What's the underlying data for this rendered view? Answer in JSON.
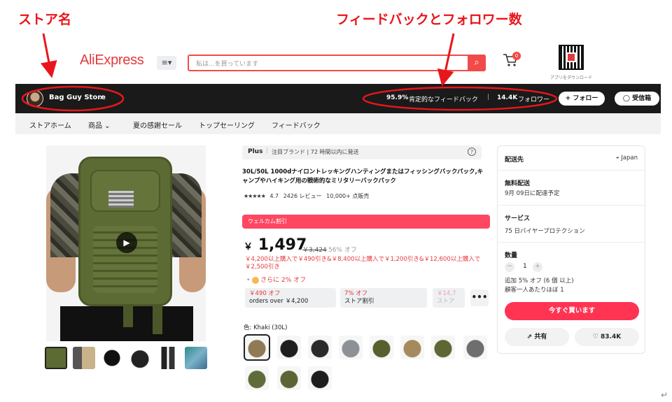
{
  "annotations": {
    "store_name_label": "ストア名",
    "feedback_label": "フィードバックとフォロワー数"
  },
  "header": {
    "logo": "AliExpress",
    "menu_icon": "≡▾",
    "search_placeholder": "私は...を買っています",
    "search_icon": "⌕",
    "cart_icon": "🛒",
    "cart_count": "0",
    "qr_label": "アプリをダウンロード"
  },
  "store": {
    "name": "Bag Guy Store",
    "chevron": "›",
    "feedback_pct": "95.9%",
    "feedback_text": "肯定的なフィードバック",
    "separator": "|",
    "followers_count": "14.4K",
    "followers_text": "フォロワー",
    "follow_button": "+ フォロー",
    "inbox_button": "◯ 受信箱"
  },
  "nav": [
    "ストアホーム",
    "商品 ⌄",
    "夏の感謝セール",
    "トップセーリング",
    "フィードバック"
  ],
  "product": {
    "plus_badge": "Plus",
    "plus_sep": "|",
    "plus_text": "注目ブランド | 72 時間以内に発送",
    "info_icon": "?",
    "title": "30L/50L 1000dナイロントレッキングハンティングまたはフィッシングバックパック,キャンプやハイキング用の戦術的なミリタリーバックパック",
    "stars": "★★★★★",
    "rating": "4.7",
    "reviews": "2426 レビュー",
    "sold": "10,000+ 点販売",
    "welcome_banner": "ウェルカム割引",
    "currency": "￥",
    "price": "1,497",
    "old_price": "￥3,424",
    "discount": "56% オフ",
    "promo_text": "￥4,200以上購入で￥490引き&￥8,400以上購入で￥1,200引き&￥12,600以上購入で￥2,500引き",
    "extra_discount": "さらに 2% オフ",
    "coupons": [
      {
        "title": "￥490 オフ",
        "sub": "orders over ￥4,200"
      },
      {
        "title": "7% オフ",
        "sub": "ストア割引"
      },
      {
        "title": "￥14,7",
        "sub": "ストア"
      }
    ],
    "more_icon": "•••",
    "color_label": "色: Khaki (30L)",
    "play_icon": "▶"
  },
  "sidebar": {
    "ship_to_label": "配送先",
    "location": "⌖ Japan",
    "free_ship_label": "無料配送",
    "delivery": "9月 09日に配達予定",
    "service_label": "サービス",
    "service": "75 日バイヤープロテクション",
    "qty_label": "数量",
    "qty_minus": "−",
    "qty_value": "1",
    "qty_plus": "+",
    "qty_note1": "追加 5% オフ (6 個 以上)",
    "qty_note2": "顧客一人あたりほぼ 1",
    "buy_button": "今すぐ買います",
    "share_button": "⇗ 共有",
    "wishlist_button": "♡ 83.4K"
  },
  "corner_mark": "↵"
}
